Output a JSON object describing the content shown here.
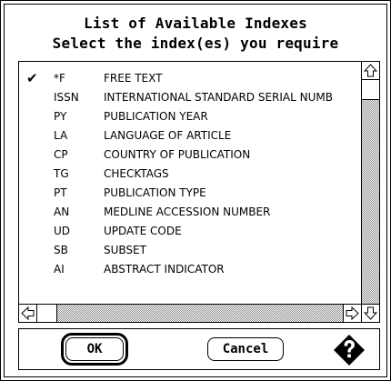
{
  "header": {
    "title": "List of Available Indexes",
    "subtitle": "Select the index(es) you require"
  },
  "index_list": {
    "rows": [
      {
        "selected": true,
        "check": "✔",
        "code": "*F",
        "description": "FREE TEXT"
      },
      {
        "selected": false,
        "check": "",
        "code": "ISSN",
        "description": "INTERNATIONAL STANDARD SERIAL NUMB"
      },
      {
        "selected": false,
        "check": "",
        "code": "PY",
        "description": "PUBLICATION YEAR"
      },
      {
        "selected": false,
        "check": "",
        "code": "LA",
        "description": "LANGUAGE OF ARTICLE"
      },
      {
        "selected": false,
        "check": "",
        "code": "CP",
        "description": "COUNTRY OF PUBLICATION"
      },
      {
        "selected": false,
        "check": "",
        "code": "TG",
        "description": "CHECKTAGS"
      },
      {
        "selected": false,
        "check": "",
        "code": "PT",
        "description": "PUBLICATION TYPE"
      },
      {
        "selected": false,
        "check": "",
        "code": "AN",
        "description": "MEDLINE ACCESSION NUMBER"
      },
      {
        "selected": false,
        "check": "",
        "code": "UD",
        "description": "UPDATE CODE"
      },
      {
        "selected": false,
        "check": "",
        "code": "SB",
        "description": "SUBSET"
      },
      {
        "selected": false,
        "check": "",
        "code": "AI",
        "description": "ABSTRACT INDICATOR"
      }
    ]
  },
  "scrollbars": {
    "vertical_position": 0,
    "horizontal_position": 0,
    "icons": [
      "scroll-up-arrow-icon",
      "scroll-down-arrow-icon",
      "scroll-left-arrow-icon",
      "scroll-right-arrow-icon"
    ]
  },
  "buttons": {
    "ok_label": "OK",
    "cancel_label": "Cancel",
    "help_icon": "help-diamond-question-icon"
  }
}
